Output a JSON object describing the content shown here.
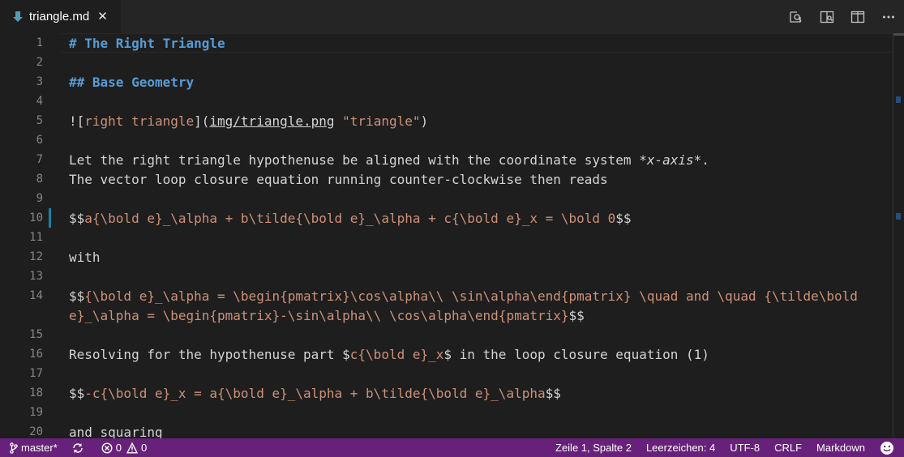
{
  "tab": {
    "title": "triangle.md",
    "close": "✕",
    "icon": "markdown-file-icon"
  },
  "actions": [
    "open-preview-icon",
    "preview-side-icon",
    "split-editor-icon",
    "more-actions-icon"
  ],
  "editor": {
    "lines": [
      {
        "n": "1",
        "segs": [
          {
            "t": "# The Right Triangle",
            "c": "h"
          }
        ]
      },
      {
        "n": "2",
        "segs": []
      },
      {
        "n": "3",
        "segs": [
          {
            "t": "## Base Geometry",
            "c": "h"
          }
        ]
      },
      {
        "n": "4",
        "segs": []
      },
      {
        "n": "5",
        "segs": [
          {
            "t": "!["
          },
          {
            "t": "right triangle",
            "c": "o"
          },
          {
            "t": "]("
          },
          {
            "t": "img/triangle.png",
            "c": "link"
          },
          {
            "t": " "
          },
          {
            "t": "\"triangle\"",
            "c": "o"
          },
          {
            "t": ")"
          }
        ]
      },
      {
        "n": "6",
        "segs": []
      },
      {
        "n": "7",
        "segs": [
          {
            "t": "Let the right triangle hypothenuse be aligned with the coordinate system "
          },
          {
            "t": "*x-axis*",
            "c": "em"
          },
          {
            "t": "."
          }
        ]
      },
      {
        "n": "8",
        "segs": [
          {
            "t": "The vector loop closure equation running counter-clockwise then reads"
          }
        ]
      },
      {
        "n": "9",
        "segs": []
      },
      {
        "n": "10",
        "mark": true,
        "segs": [
          {
            "t": "$$"
          },
          {
            "t": "a{\\bold e}_\\alpha + b\\tilde{\\bold e}_\\alpha + c{\\bold e}_x = \\bold 0",
            "c": "o"
          },
          {
            "t": "$$"
          }
        ]
      },
      {
        "n": "11",
        "segs": []
      },
      {
        "n": "12",
        "segs": [
          {
            "t": "with"
          }
        ]
      },
      {
        "n": "13",
        "segs": []
      },
      {
        "n": "14",
        "segs": [
          {
            "t": "$$"
          },
          {
            "t": "{\\bold e}_\\alpha = \\begin{pmatrix}\\cos\\alpha\\\\ \\sin\\alpha\\end{pmatrix} \\quad and \\quad {\\tilde\\bold",
            "c": "o"
          }
        ]
      },
      {
        "n": "",
        "segs": [
          {
            "t": "e}_\\alpha = \\begin{pmatrix}-\\sin\\alpha\\\\ \\cos\\alpha\\end{pmatrix}",
            "c": "o"
          },
          {
            "t": "$$"
          }
        ]
      },
      {
        "n": "15",
        "segs": []
      },
      {
        "n": "16",
        "segs": [
          {
            "t": "Resolving for the hypothenuse part $"
          },
          {
            "t": "c{\\bold e}_x",
            "c": "o"
          },
          {
            "t": "$ in the loop closure equation (1)"
          }
        ]
      },
      {
        "n": "17",
        "segs": []
      },
      {
        "n": "18",
        "segs": [
          {
            "t": "$$"
          },
          {
            "t": "-c{\\bold e}_x = a{\\bold e}_\\alpha + b\\tilde{\\bold e}_\\alpha",
            "c": "o"
          },
          {
            "t": "$$"
          }
        ]
      },
      {
        "n": "19",
        "segs": []
      },
      {
        "n": "20",
        "segs": [
          {
            "t": "and squaring"
          }
        ]
      }
    ]
  },
  "status": {
    "branch": "master*",
    "errors": "0",
    "warnings": "0",
    "position": "Zeile 1, Spalte 2",
    "indent": "Leerzeichen: 4",
    "encoding": "UTF-8",
    "eol": "CRLF",
    "language": "Markdown",
    "feedback_icon": "smiley-icon"
  }
}
